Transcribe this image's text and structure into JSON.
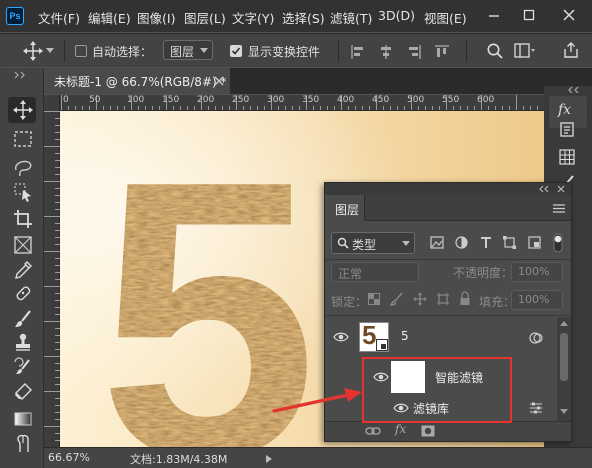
{
  "app": {
    "name": "Photoshop",
    "logo_text": "Ps"
  },
  "menu": [
    "文件(F)",
    "编辑(E)",
    "图像(I)",
    "图层(L)",
    "文字(Y)",
    "选择(S)",
    "滤镜(T)",
    "3D(D)",
    "视图(E)"
  ],
  "options_bar": {
    "auto_select_label": "自动选择：",
    "auto_select_checked": false,
    "auto_select_target": "图层",
    "show_transform_label": "显示变换控件",
    "show_transform_checked": true
  },
  "document": {
    "tab_title": "未标题-1 @ 66.7%(RGB/8#) *"
  },
  "ruler": {
    "labels": [
      "0",
      "50",
      "100",
      "150",
      "200",
      "250",
      "300",
      "350",
      "400",
      "450",
      "500",
      "550",
      "600"
    ]
  },
  "canvas": {
    "glyph": "5",
    "bg_colors": [
      "#fdf1d4",
      "#eec98a"
    ]
  },
  "layers_panel": {
    "title": "图层",
    "filter_kind": "类型",
    "blend_mode": "正常",
    "opacity_label": "不透明度：",
    "opacity_value": "100%",
    "lock_label": "锁定：",
    "fill_label": "填充：",
    "fill_value": "100%",
    "layer": {
      "name": "5",
      "thumb_text": "5"
    },
    "smart_filters_label": "智能滤镜",
    "filter_gallery_label": "滤镜库",
    "highlight_color": "#e3342f"
  },
  "status_bar": {
    "zoom": "66.67%",
    "doc_info": "文档:1.83M/4.38M"
  }
}
